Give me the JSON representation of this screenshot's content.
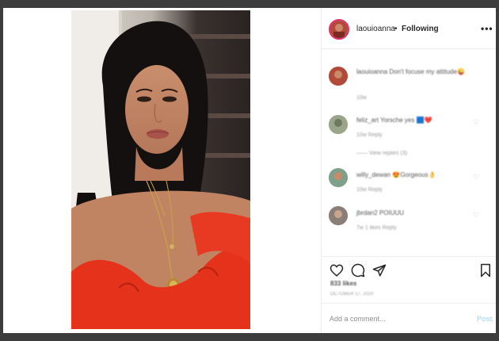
{
  "header": {
    "username": "laouioanna",
    "separator": "•",
    "follow_state": "Following",
    "more_icon": "more-horizontal-icon"
  },
  "comments": [
    {
      "user": "laouioanna",
      "text": "laouioanna Don't focuse my attitude😜",
      "meta": "10w"
    },
    {
      "user": "feliz_art",
      "text": "feliz_art Yorsche yes 🟦❤️",
      "meta": "10w   Reply",
      "replies": "——   View replies (3)"
    },
    {
      "user": "willy_dewan",
      "text": "willy_dewan 😍Gorgeous👌",
      "meta": "10w   Reply"
    },
    {
      "user": "jbrdan2",
      "text": "jbrdan2 POIUUU",
      "meta": "7w   1 likes   Reply"
    }
  ],
  "actions": {
    "like_icon": "heart-icon",
    "comment_icon": "comment-icon",
    "share_icon": "share-icon",
    "save_icon": "bookmark-icon"
  },
  "likes": "833 likes",
  "date": "OCTOBER 17, 2020",
  "add_comment": {
    "placeholder": "Add a comment...",
    "post_label": "Post"
  },
  "colors": {
    "ring": "#e1306c",
    "post_disabled": "#b2dffc",
    "dress": "#e4321b"
  }
}
